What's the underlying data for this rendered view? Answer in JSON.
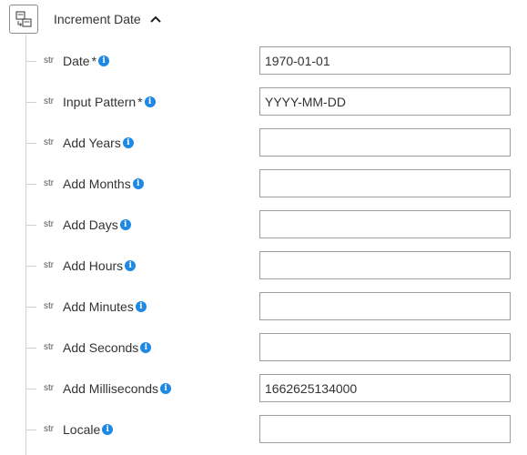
{
  "node": {
    "title": "Increment Date",
    "icon": "calendar-transform-icon",
    "collapse_icon": "chevron-up-icon"
  },
  "accent_color": "#1e88e5",
  "fields": [
    {
      "type": "str",
      "label": "Date",
      "required": "*",
      "value": ""
    },
    {
      "type": "str",
      "label": "Input Pattern",
      "required": "*",
      "value": ""
    },
    {
      "type": "str",
      "label": "Add Years",
      "required": "",
      "value": ""
    },
    {
      "type": "str",
      "label": "Add Months",
      "required": "",
      "value": ""
    },
    {
      "type": "str",
      "label": "Add Days",
      "required": "",
      "value": ""
    },
    {
      "type": "str",
      "label": "Add Hours",
      "required": "",
      "value": ""
    },
    {
      "type": "str",
      "label": "Add Minutes",
      "required": "",
      "value": ""
    },
    {
      "type": "str",
      "label": "Add Seconds",
      "required": "",
      "value": ""
    },
    {
      "type": "str",
      "label": "Add Milliseconds",
      "required": "",
      "value": ""
    },
    {
      "type": "str",
      "label": "Locale",
      "required": "",
      "value": ""
    }
  ],
  "values": [
    "1970-01-01",
    "YYYY-MM-DD",
    "",
    "",
    "",
    "",
    "",
    "",
    "1662625134000",
    ""
  ]
}
